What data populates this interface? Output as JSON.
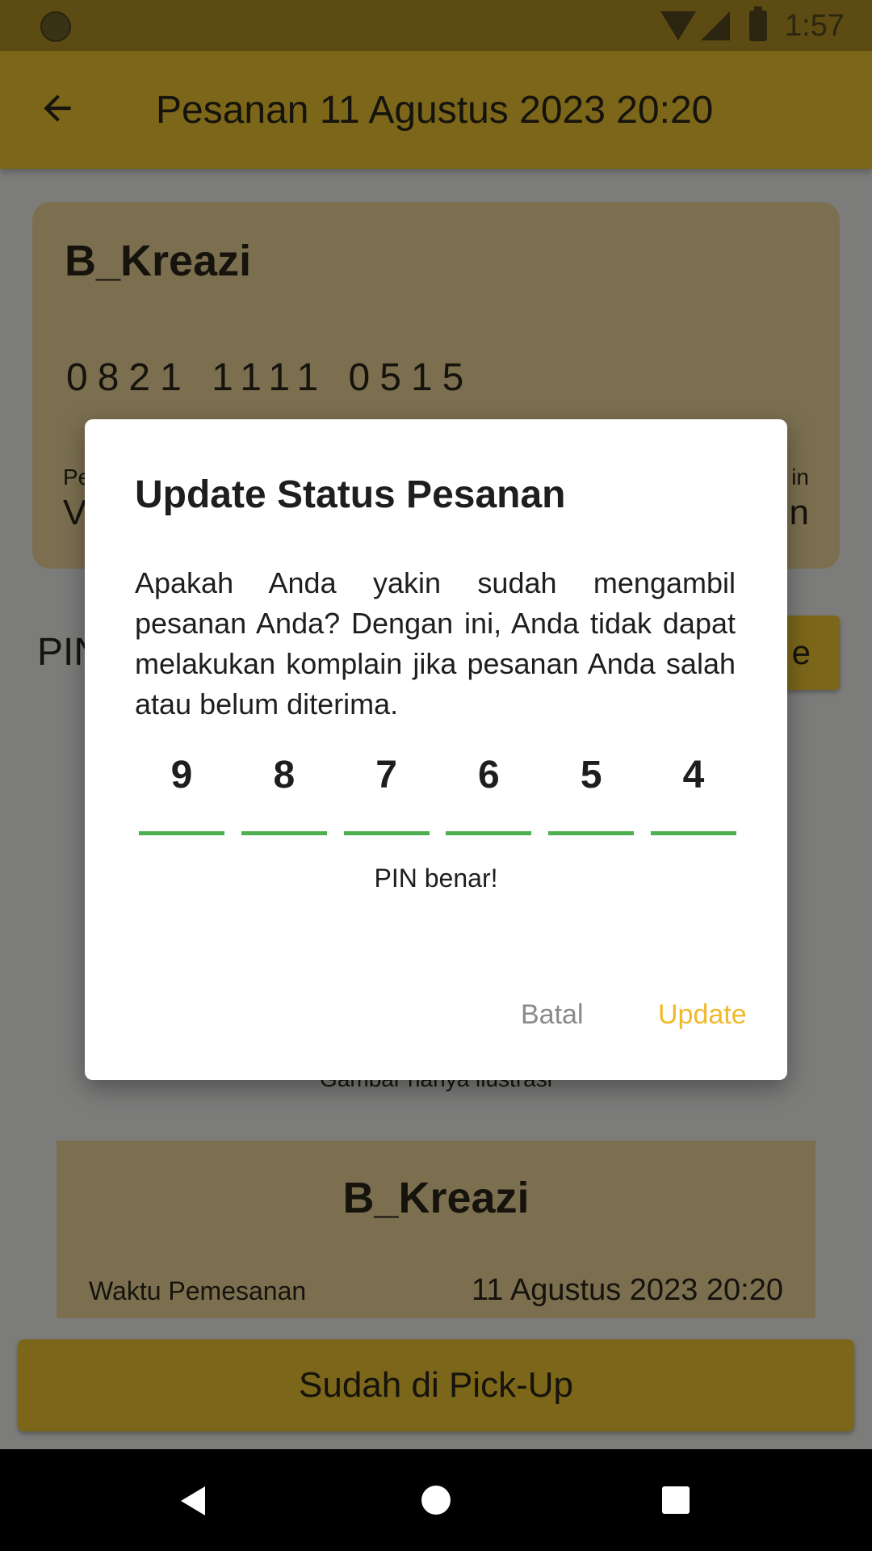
{
  "status_bar": {
    "time": "1:57"
  },
  "app_bar": {
    "title": "Pesanan  11 Agustus 2023  20:20"
  },
  "info_card": {
    "name": "B_Kreazi",
    "phone": "0821 1111 0515",
    "left_label": "Pe",
    "left_value": "V",
    "right_label": "in",
    "right_value": "n"
  },
  "pin_section": {
    "label": "PIN",
    "button_label": "e"
  },
  "illustration_caption": "Gambar hanya ilustrasi",
  "order_card": {
    "name": "B_Kreazi",
    "time_label": "Waktu Pemesanan",
    "time_value": "11 Agustus 2023  20:20"
  },
  "pickup_button": "Sudah di Pick-Up",
  "dialog": {
    "title": "Update Status Pesanan",
    "message": "Apakah Anda yakin sudah mengambil pesanan Anda? Dengan ini, Anda tidak dapat melakukan komplain jika pesanan Anda salah atau belum diterima.",
    "pin_digits": [
      "9",
      "8",
      "7",
      "6",
      "5",
      "4"
    ],
    "pin_status": "PIN benar!",
    "cancel_label": "Batal",
    "update_label": "Update"
  },
  "colors": {
    "accent": "#f0b92a",
    "pin_underline": "#4caf50",
    "cancel_text": "#8a8a8a"
  },
  "icons": {
    "back": "arrow-left",
    "nav_back": "triangle-back",
    "nav_home": "circle-home",
    "nav_recent": "square-recent"
  }
}
